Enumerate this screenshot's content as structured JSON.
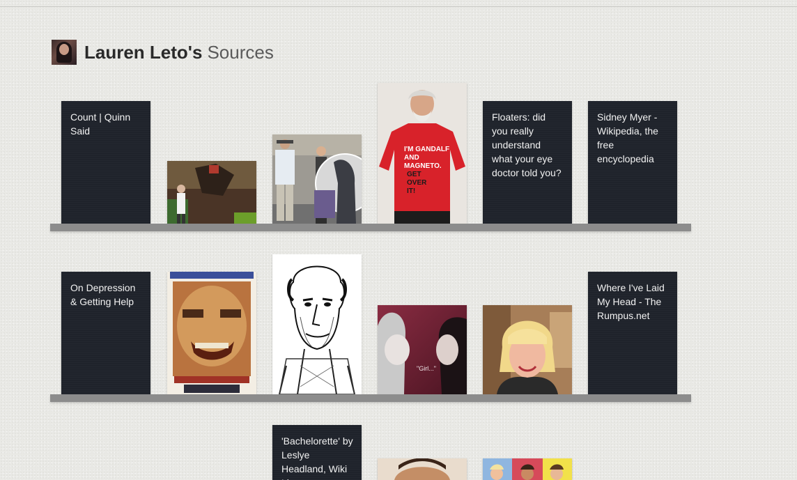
{
  "header": {
    "name": "Lauren Leto's",
    "suffix": "Sources",
    "avatar_icon": "profile-photo"
  },
  "shelves": [
    {
      "items": [
        {
          "type": "text",
          "title": "Count | Quinn Said"
        },
        {
          "type": "image",
          "subject": "protest painting with speaker"
        },
        {
          "type": "image",
          "subject": "celebrities walking on street"
        },
        {
          "type": "image",
          "subject": "man in red t-shirt",
          "shirt_text": "I'M GANDALF AND MAGNETO. GET OVER IT!"
        },
        {
          "type": "text",
          "title": "Floaters: did you really understand what your eye doctor told you?"
        },
        {
          "type": "text",
          "title": "Sidney Myer - Wikipedia, the free encyclopedia"
        }
      ]
    },
    {
      "items": [
        {
          "type": "text",
          "title": "On Depression & Getting Help"
        },
        {
          "type": "image",
          "subject": "blurry face book cover"
        },
        {
          "type": "image",
          "subject": "caricature drawing of man"
        },
        {
          "type": "image",
          "subject": "two women face to face",
          "caption": "\"Girl...\""
        },
        {
          "type": "image",
          "subject": "blonde woman smiling"
        },
        {
          "type": "text",
          "title": "Where I've Laid My Head - The Rumpus.net"
        }
      ]
    },
    {
      "items": [
        {
          "type": "text",
          "title": "'Bachelorette' by Leslye Headland, Wiki Li"
        },
        {
          "type": "image",
          "subject": "face close-up"
        },
        {
          "type": "image",
          "subject": "magazine covers"
        }
      ]
    }
  ]
}
